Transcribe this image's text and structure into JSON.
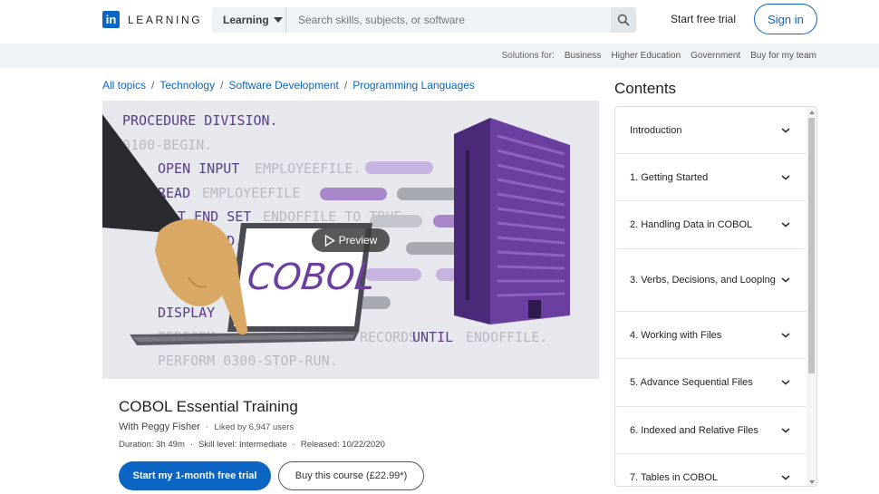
{
  "header": {
    "logo_mark": "in",
    "logo_text": "LEARNING",
    "category_label": "Learning",
    "search_placeholder": "Search skills, subjects, or software",
    "start_trial_label": "Start free trial",
    "signin_label": "Sign in"
  },
  "solutions": {
    "label": "Solutions for:",
    "items": [
      "Business",
      "Higher Education",
      "Government",
      "Buy for my team"
    ]
  },
  "breadcrumb": [
    "All topics",
    "Technology",
    "Software Development",
    "Programming Languages"
  ],
  "hero": {
    "code_lines": [
      "PROCEDURE DIVISION.",
      "0100-BEGIN.",
      "OPEN INPUT",
      "EMPLOYEEFILE.",
      "READ",
      "EMPLOYEEFILE",
      "AT END SET",
      "ENDOFFILE TO TRUE",
      "READ.",
      "DISPLAY",
      "PERFORM",
      "RECORDS",
      "UNTIL",
      "ENDOFFILE.",
      "PERFORM 0300-STOP-RUN."
    ],
    "laptop_text": "COBOL",
    "preview_label": "Preview"
  },
  "course": {
    "title": "COBOL Essential Training",
    "author": "With Peggy Fisher",
    "likes": "Liked by 6,947 users",
    "duration": "Duration: 3h 49m",
    "skill_level": "Skill level: Intermediate",
    "released": "Released: 10/22/2020",
    "primary_cta": "Start my 1-month free trial",
    "secondary_cta": "Buy this course (£22.99*)"
  },
  "contents": {
    "title": "Contents",
    "chapters": [
      "Introduction",
      "1. Getting Started",
      "2. Handling Data in COBOL",
      "3. Verbs, Decisions, and Looping",
      "4. Working with Files",
      "5. Advance Sequential Files",
      "6. Indexed and Relative Files",
      "7. Tables in COBOL"
    ]
  },
  "colors": {
    "brand": "#0a66c2",
    "code_dark": "#5a3e86",
    "code_light": "#b8b9c2",
    "building": "#6b3fa0"
  }
}
